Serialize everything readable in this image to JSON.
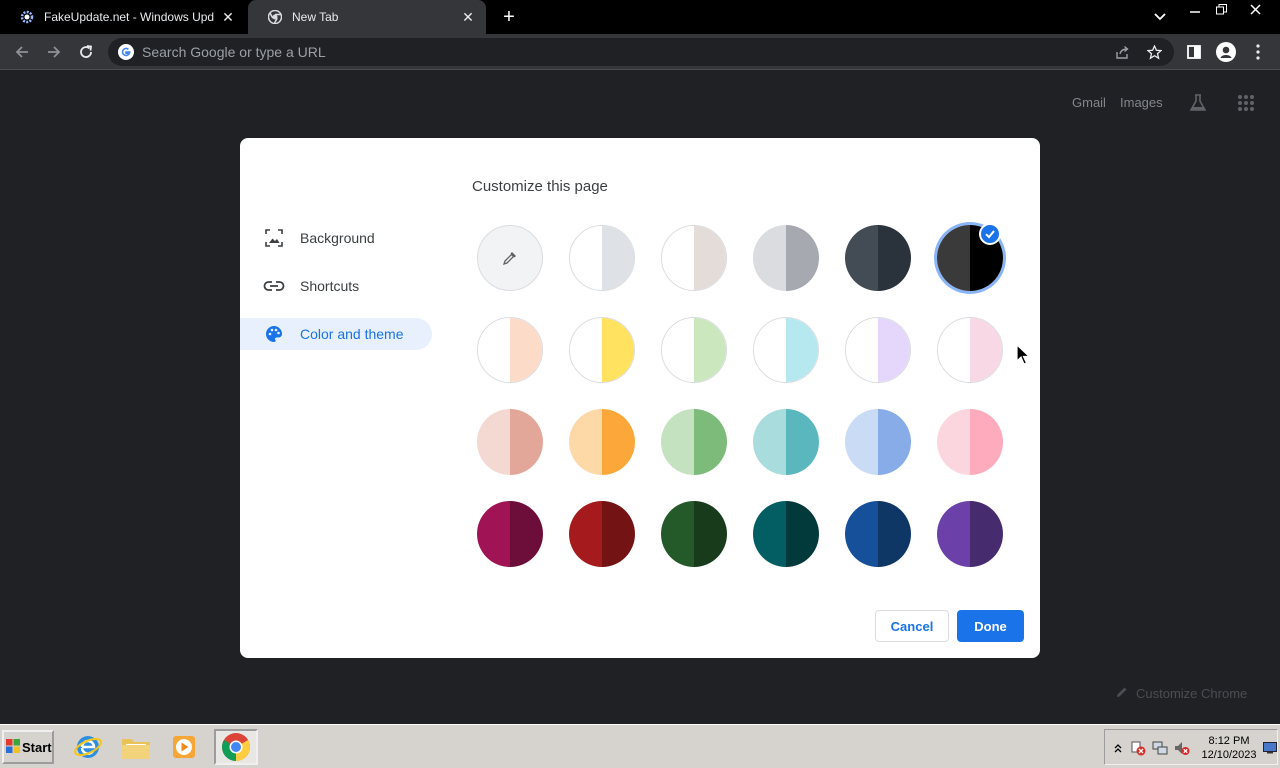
{
  "tabs": [
    {
      "title": "FakeUpdate.net - Windows Update Prank",
      "favicon": "gear-icon",
      "active": false
    },
    {
      "title": "New Tab",
      "favicon": "chrome-icon",
      "active": true
    }
  ],
  "toolbar": {
    "omnibox_placeholder": "Search Google or type a URL"
  },
  "ntp": {
    "gmail": "Gmail",
    "images": "Images",
    "customize_chrome": "Customize Chrome"
  },
  "dialog": {
    "title": "Customize this page",
    "menu": [
      {
        "label": "Background",
        "icon": "image-icon",
        "selected": false
      },
      {
        "label": "Shortcuts",
        "icon": "link-icon",
        "selected": false
      },
      {
        "label": "Color and theme",
        "icon": "palette-icon",
        "selected": true
      }
    ],
    "swatches": [
      {
        "left": "custom",
        "right": "custom",
        "custom": true
      },
      {
        "left": "#ffffff",
        "right": "#dee1e6"
      },
      {
        "left": "#ffffff",
        "right": "#e3dcd9"
      },
      {
        "left": "#dadce0",
        "right": "#a7a9b0"
      },
      {
        "left": "#434c55",
        "right": "#2a333b"
      },
      {
        "left": "#3a3a3a",
        "right": "#000000",
        "selected": true
      },
      {
        "left": "#ffffff",
        "right": "#fcdcc8"
      },
      {
        "left": "#ffffff",
        "right": "#fee260"
      },
      {
        "left": "#ffffff",
        "right": "#cae7be"
      },
      {
        "left": "#ffffff",
        "right": "#b6e8f0"
      },
      {
        "left": "#ffffff",
        "right": "#e4d7fb"
      },
      {
        "left": "#ffffff",
        "right": "#f8d8e4"
      },
      {
        "left": "#f4d9d2",
        "right": "#e3a79a"
      },
      {
        "left": "#fdd9a8",
        "right": "#fca73a"
      },
      {
        "left": "#c4e1c0",
        "right": "#7dbb7b"
      },
      {
        "left": "#a9dcdc",
        "right": "#5bb7be"
      },
      {
        "left": "#c9dbf5",
        "right": "#88ace7"
      },
      {
        "left": "#fbd6df",
        "right": "#fdabbd"
      },
      {
        "left": "#a01355",
        "right": "#6d0d39"
      },
      {
        "left": "#a51a1d",
        "right": "#731314"
      },
      {
        "left": "#245a2a",
        "right": "#183c1b"
      },
      {
        "left": "#025e63",
        "right": "#023a3c"
      },
      {
        "left": "#16509b",
        "right": "#0e3766"
      },
      {
        "left": "#6b40a9",
        "right": "#472b6f"
      }
    ],
    "cancel_label": "Cancel",
    "done_label": "Done"
  },
  "taskbar": {
    "start_label": "Start",
    "time": "8:12 PM",
    "date": "12/10/2023"
  }
}
